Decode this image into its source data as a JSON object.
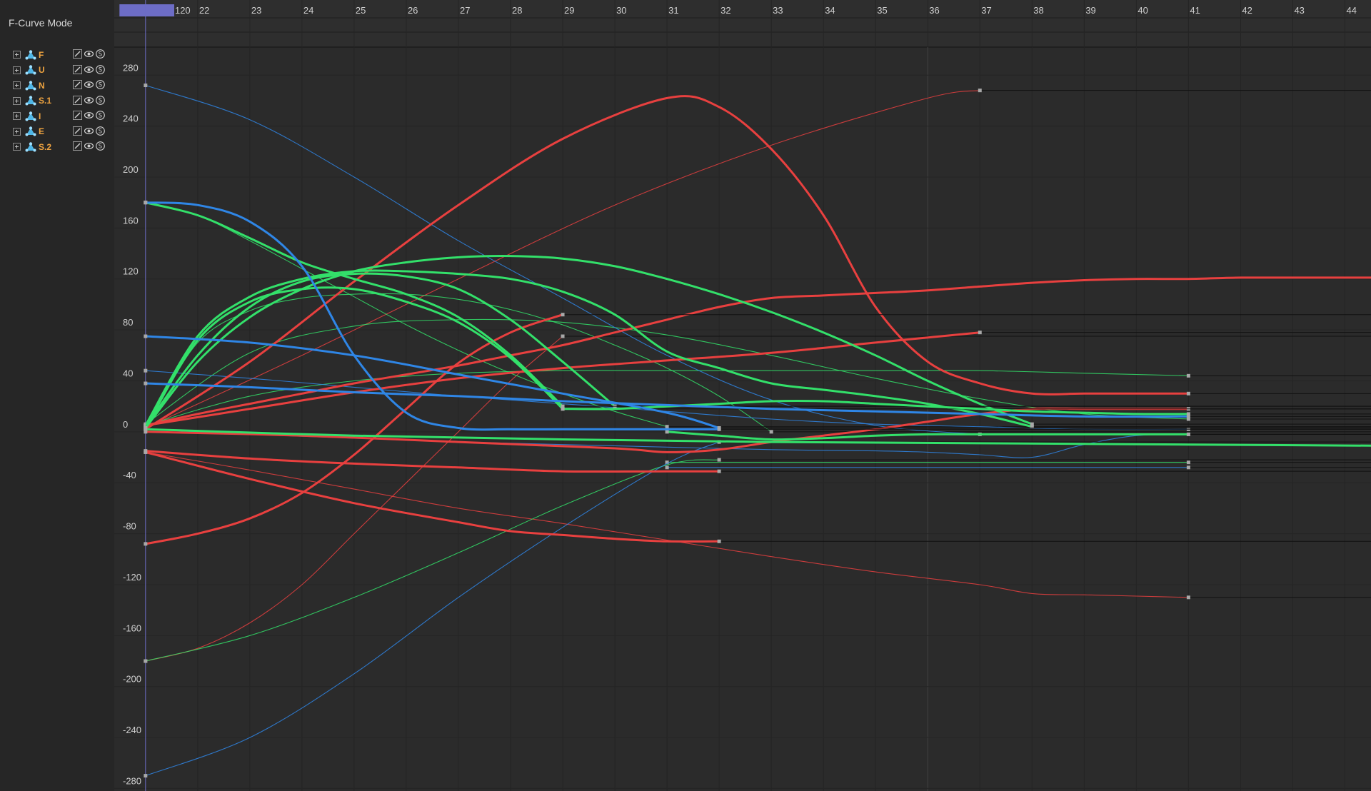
{
  "panel": {
    "title": "F-Curve Mode",
    "objects": [
      {
        "name": "F"
      },
      {
        "name": "U"
      },
      {
        "name": "N"
      },
      {
        "name": "S.1"
      },
      {
        "name": "I"
      },
      {
        "name": "E"
      },
      {
        "name": "S.2"
      }
    ]
  },
  "timeline": {
    "current_frame_label": "120",
    "highlight_color": "#6d6dc6"
  },
  "chart_data": {
    "type": "line",
    "title": "",
    "xlabel": "",
    "ylabel": "",
    "x_ticks": [
      22,
      23,
      24,
      25,
      26,
      27,
      28,
      29,
      30,
      31,
      32,
      33,
      34,
      35,
      36,
      37,
      38,
      39,
      40,
      41,
      42,
      43,
      44
    ],
    "y_ticks": [
      280,
      240,
      200,
      160,
      120,
      80,
      40,
      0,
      -40,
      -80,
      -120,
      -160,
      -200,
      -240,
      -280
    ],
    "xlim": [
      20.4,
      44.5
    ],
    "ylim": [
      -282,
      302
    ],
    "grid": true,
    "colors": {
      "red": "#e8403f",
      "green": "#33e06a",
      "blue": "#2f86e6"
    },
    "series": [
      {
        "color": "red",
        "thick": true,
        "x": [
          21,
          23,
          25,
          27,
          29,
          31,
          32,
          33,
          34,
          35,
          36,
          37,
          38,
          39,
          40,
          41
        ],
        "y": [
          2,
          55,
          118,
          178,
          230,
          262,
          255,
          222,
          170,
          98,
          55,
          38,
          30,
          30,
          30,
          30
        ]
      },
      {
        "color": "red",
        "thick": true,
        "x": [
          21,
          22,
          23,
          24,
          25,
          26,
          27,
          28,
          29,
          30,
          31,
          32,
          33,
          34,
          35,
          36,
          37,
          38,
          39,
          40,
          41,
          42,
          43,
          44,
          45
        ],
        "y": [
          5,
          14,
          22,
          30,
          38,
          45,
          52,
          60,
          68,
          78,
          88,
          98,
          105,
          107,
          109,
          111,
          114,
          117,
          119,
          120,
          120,
          121,
          121,
          121,
          121
        ]
      },
      {
        "color": "red",
        "thick": true,
        "x": [
          21,
          23,
          25,
          27,
          29,
          31,
          33,
          35,
          37
        ],
        "y": [
          5,
          18,
          31,
          42,
          50,
          56,
          62,
          70,
          78
        ]
      },
      {
        "color": "red",
        "thick": false,
        "x": [
          21,
          24,
          27,
          30,
          33,
          36,
          37
        ],
        "y": [
          3,
          60,
          120,
          178,
          225,
          262,
          268
        ]
      },
      {
        "color": "red",
        "thick": true,
        "x": [
          21,
          22,
          23,
          24,
          25,
          26,
          27,
          28,
          29
        ],
        "y": [
          -88,
          -80,
          -68,
          -48,
          -18,
          18,
          54,
          78,
          92
        ]
      },
      {
        "color": "red",
        "thick": true,
        "x": [
          21,
          23,
          25,
          27,
          28,
          29,
          30,
          31,
          32
        ],
        "y": [
          -16,
          -37,
          -56,
          -71,
          -78,
          -81,
          -84,
          -86,
          -86
        ]
      },
      {
        "color": "red",
        "thick": true,
        "x": [
          21,
          23,
          25,
          27,
          29,
          31,
          32
        ],
        "y": [
          -15,
          -21,
          -25,
          -28,
          -31,
          -31,
          -31
        ]
      },
      {
        "color": "red",
        "thick": false,
        "x": [
          21,
          23,
          25,
          27,
          29,
          31,
          33,
          35,
          37,
          38,
          39,
          40,
          41
        ],
        "y": [
          -16,
          -30,
          -45,
          -60,
          -72,
          -85,
          -98,
          -110,
          -120,
          -127,
          -128,
          -129,
          -130
        ]
      },
      {
        "color": "red",
        "thick": false,
        "x": [
          21,
          22,
          23,
          24,
          25,
          26,
          27,
          28,
          29
        ],
        "y": [
          -180,
          -170,
          -150,
          -120,
          -80,
          -40,
          0,
          40,
          75
        ]
      },
      {
        "color": "red",
        "thick": true,
        "x": [
          21,
          24,
          27,
          30,
          31,
          32,
          33,
          34,
          35,
          36,
          37,
          38,
          39,
          40,
          41
        ],
        "y": [
          0,
          -3,
          -8,
          -13,
          -16,
          -14,
          -8,
          -3,
          2,
          8,
          14,
          18,
          18,
          18,
          18
        ]
      },
      {
        "color": "green",
        "thick": true,
        "x": [
          21,
          22,
          23,
          24,
          25,
          26,
          27,
          28,
          29,
          30,
          31,
          32,
          33,
          34,
          35,
          36,
          37,
          38
        ],
        "y": [
          5,
          75,
          106,
          120,
          126,
          126,
          124,
          120,
          110,
          92,
          63,
          50,
          38,
          33,
          28,
          22,
          14,
          4
        ]
      },
      {
        "color": "green",
        "thick": true,
        "x": [
          21,
          22,
          23,
          24,
          25,
          26,
          27,
          28,
          29,
          30,
          31,
          32,
          33,
          34,
          35,
          36,
          37,
          38
        ],
        "y": [
          3,
          55,
          90,
          112,
          126,
          133,
          137,
          138,
          136,
          130,
          120,
          108,
          94,
          78,
          60,
          40,
          22,
          6
        ]
      },
      {
        "color": "green",
        "thick": true,
        "x": [
          21,
          22,
          23,
          24,
          25,
          26,
          27,
          28,
          29,
          30
        ],
        "y": [
          4,
          60,
          98,
          118,
          124,
          122,
          112,
          88,
          55,
          20
        ]
      },
      {
        "color": "green",
        "thick": true,
        "x": [
          21,
          22,
          23,
          24,
          25,
          26,
          27,
          28,
          29
        ],
        "y": [
          3,
          72,
          102,
          112,
          112,
          102,
          86,
          58,
          18
        ]
      },
      {
        "color": "green",
        "thick": true,
        "x": [
          21,
          22,
          23,
          24,
          25,
          26,
          27,
          28,
          29
        ],
        "y": [
          180,
          170,
          152,
          133,
          120,
          108,
          90,
          60,
          20
        ]
      },
      {
        "color": "green",
        "thick": true,
        "x": [
          29,
          30,
          31,
          32,
          33,
          34,
          35,
          36,
          37,
          38,
          39,
          40,
          41
        ],
        "y": [
          18,
          18,
          20,
          22,
          24,
          24,
          22,
          20,
          18,
          16,
          15,
          14,
          14
        ]
      },
      {
        "color": "green",
        "thick": true,
        "x": [
          21,
          25,
          29,
          33,
          37,
          41,
          45
        ],
        "y": [
          2,
          -3,
          -6,
          -8,
          -9,
          -10,
          -11
        ]
      },
      {
        "color": "green",
        "thick": true,
        "x": [
          31,
          32,
          33,
          34,
          35,
          36,
          37,
          38,
          39,
          40,
          41
        ],
        "y": [
          0,
          -3,
          -6,
          -5,
          -3,
          -2,
          -2,
          -2,
          -2,
          -2,
          -2
        ]
      },
      {
        "color": "green",
        "thick": false,
        "x": [
          21,
          23,
          25,
          27,
          29,
          31,
          33,
          35,
          37,
          39,
          41
        ],
        "y": [
          5,
          28,
          40,
          46,
          48,
          48,
          48,
          48,
          48,
          46,
          44
        ]
      },
      {
        "color": "green",
        "thick": false,
        "x": [
          21,
          23,
          25,
          27,
          29,
          31,
          33,
          35,
          37,
          39,
          41
        ],
        "y": [
          6,
          62,
          83,
          88,
          86,
          76,
          60,
          42,
          26,
          14,
          10
        ]
      },
      {
        "color": "green",
        "thick": false,
        "x": [
          21,
          22,
          23,
          24,
          25,
          26,
          27,
          28,
          29,
          30,
          31,
          32,
          33
        ],
        "y": [
          5,
          70,
          95,
          105,
          108,
          108,
          104,
          96,
          84,
          68,
          50,
          28,
          0
        ]
      },
      {
        "color": "green",
        "thick": false,
        "x": [
          21,
          22,
          23,
          24,
          25,
          26,
          27,
          28,
          29,
          30,
          31
        ],
        "y": [
          180,
          170,
          150,
          128,
          106,
          84,
          64,
          46,
          30,
          16,
          4
        ]
      },
      {
        "color": "green",
        "thick": false,
        "x": [
          21,
          23,
          25,
          27,
          29,
          31,
          32
        ],
        "y": [
          -180,
          -160,
          -130,
          -95,
          -58,
          -26,
          -22
        ]
      },
      {
        "color": "green",
        "thick": false,
        "x": [
          31,
          33,
          35,
          37,
          39,
          41
        ],
        "y": [
          -24,
          -24,
          -24,
          -24,
          -24,
          -24
        ]
      },
      {
        "color": "blue",
        "thick": true,
        "x": [
          21,
          22,
          23,
          24,
          25,
          26,
          27,
          28,
          29,
          30,
          31,
          32
        ],
        "y": [
          180,
          178,
          165,
          130,
          60,
          15,
          3,
          2,
          2,
          2,
          2,
          2
        ]
      },
      {
        "color": "blue",
        "thick": true,
        "x": [
          21,
          23,
          25,
          27,
          29,
          31,
          32
        ],
        "y": [
          75,
          70,
          60,
          45,
          30,
          15,
          3
        ]
      },
      {
        "color": "blue",
        "thick": true,
        "x": [
          21,
          23,
          25,
          27,
          29,
          31,
          33,
          35,
          37,
          39,
          41
        ],
        "y": [
          38,
          35,
          31,
          28,
          24,
          21,
          18,
          16,
          14,
          12,
          12
        ]
      },
      {
        "color": "blue",
        "thick": false,
        "x": [
          21,
          23,
          25,
          27,
          29,
          31,
          33,
          35,
          37
        ],
        "y": [
          272,
          245,
          200,
          150,
          105,
          60,
          25,
          5,
          -2
        ]
      },
      {
        "color": "blue",
        "thick": false,
        "x": [
          21,
          23,
          25,
          27,
          29,
          31,
          33,
          35,
          36,
          37,
          38,
          39,
          40,
          41
        ],
        "y": [
          2,
          -2,
          -5,
          -8,
          -10,
          -12,
          -14,
          -15,
          -16,
          -18,
          -20,
          -10,
          -3,
          -2
        ]
      },
      {
        "color": "blue",
        "thick": false,
        "x": [
          21,
          23,
          25,
          27,
          29,
          31,
          32
        ],
        "y": [
          -270,
          -240,
          -190,
          -130,
          -75,
          -25,
          -8
        ]
      },
      {
        "color": "blue",
        "thick": false,
        "x": [
          21,
          23,
          25,
          27,
          29,
          31,
          33,
          35,
          37,
          39,
          41
        ],
        "y": [
          48,
          42,
          35,
          28,
          22,
          16,
          10,
          6,
          4,
          2,
          2
        ]
      },
      {
        "color": "blue",
        "thick": false,
        "x": [
          31,
          33,
          35,
          37,
          38,
          39,
          40,
          41
        ],
        "y": [
          -28,
          -28,
          -28,
          -28,
          -28,
          -28,
          -28,
          -28
        ]
      }
    ]
  }
}
